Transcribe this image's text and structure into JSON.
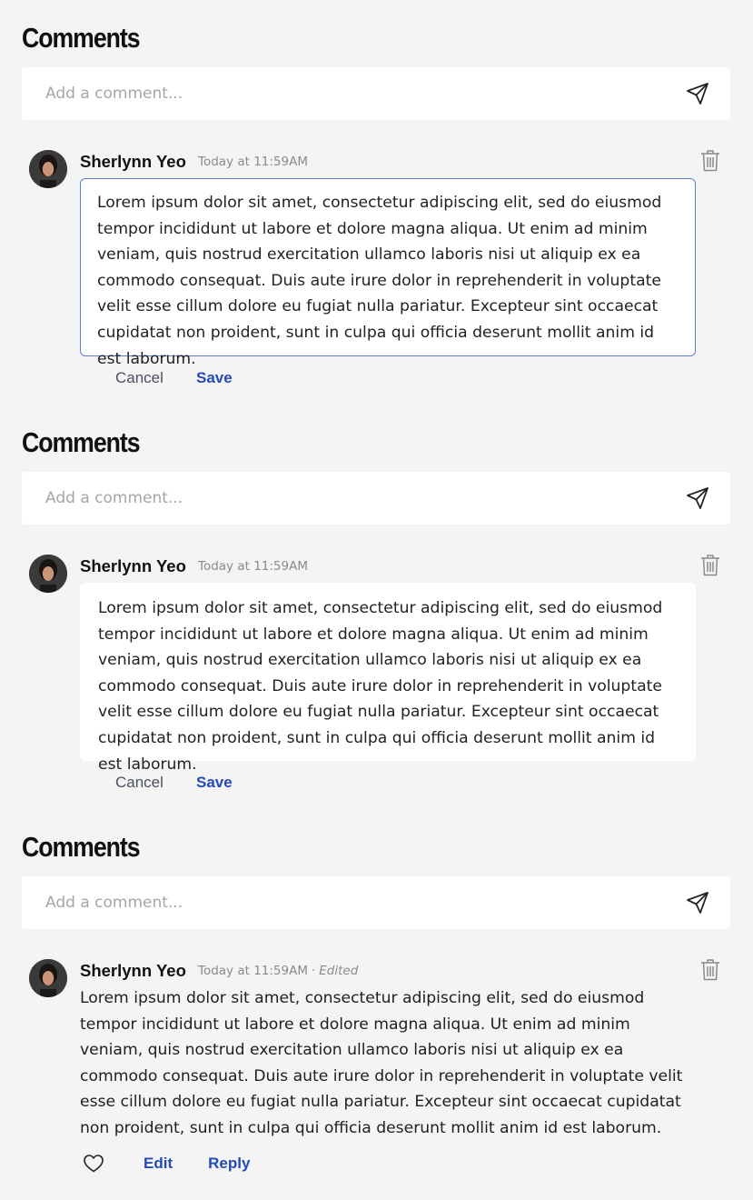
{
  "sections": [
    {
      "heading": "Comments",
      "composer": {
        "placeholder": "Add a comment...",
        "value": ""
      },
      "comment": {
        "author": "Sherlynn Yeo",
        "timestamp": "Today at 11:59AM",
        "state": "editing-focused",
        "text": "Lorem ipsum dolor sit amet, consectetur adipiscing elit, sed do eiusmod tempor incididunt ut labore et dolore magna aliqua. Ut enim ad minim veniam, quis nostrud exercitation ullamco laboris nisi ut aliquip ex ea commodo consequat. Duis aute irure dolor in reprehenderit in voluptate velit esse cillum dolore eu fugiat nulla pariatur. Excepteur sint occaecat cupidatat non proident, sunt in culpa qui officia deserunt mollit anim id est laborum.",
        "cancel_label": "Cancel",
        "save_label": "Save"
      }
    },
    {
      "heading": "Comments",
      "composer": {
        "placeholder": "Add a comment...",
        "value": ""
      },
      "comment": {
        "author": "Sherlynn Yeo",
        "timestamp": "Today at 11:59AM",
        "state": "editing",
        "text": "Lorem ipsum dolor sit amet, consectetur adipiscing elit, sed do eiusmod tempor incididunt ut labore et dolore magna aliqua. Ut enim ad minim veniam, quis nostrud exercitation ullamco laboris nisi ut aliquip ex ea commodo consequat. Duis aute irure dolor in reprehenderit in voluptate velit esse cillum dolore eu fugiat nulla pariatur. Excepteur sint occaecat cupidatat non proident, sunt in culpa qui officia deserunt mollit anim id est laborum.",
        "cancel_label": "Cancel",
        "save_label": "Save"
      }
    },
    {
      "heading": "Comments",
      "composer": {
        "placeholder": "Add a comment...",
        "value": ""
      },
      "comment": {
        "author": "Sherlynn Yeo",
        "timestamp": "Today at 11:59AM",
        "separator": "·",
        "edited_label": "Edited",
        "state": "posted",
        "text": "Lorem ipsum dolor sit amet, consectetur adipiscing elit, sed do eiusmod tempor incididunt ut labore et dolore magna aliqua. Ut enim ad minim veniam, quis nostrud exercitation ullamco laboris nisi ut aliquip ex ea commodo consequat. Duis aute irure dolor in reprehenderit in voluptate velit esse cillum dolore eu fugiat nulla pariatur. Excepteur sint occaecat cupidatat non proident, sunt in culpa qui officia deserunt mollit anim id est laborum.",
        "edit_label": "Edit",
        "reply_label": "Reply"
      }
    }
  ],
  "icons": {
    "send": "send-icon",
    "delete": "trash-icon",
    "like": "heart-icon"
  },
  "colors": {
    "background": "#f4f4f4",
    "focus_border": "#5f7bd0",
    "link": "#2449b8",
    "muted": "#8a8a8a"
  }
}
